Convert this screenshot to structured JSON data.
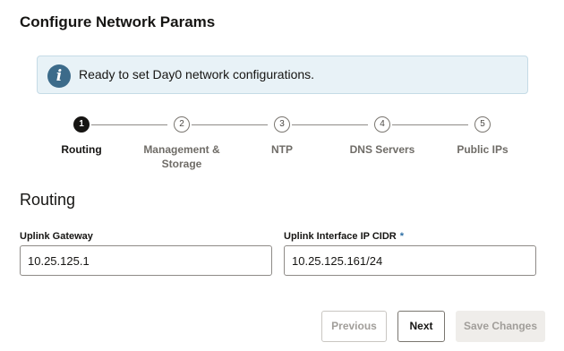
{
  "page": {
    "title": "Configure Network Params"
  },
  "info": {
    "icon": "info-icon",
    "glyph": "i",
    "message": "Ready to set Day0 network configurations."
  },
  "steps": [
    {
      "number": "1",
      "label": "Routing",
      "active": true
    },
    {
      "number": "2",
      "label": "Management &",
      "label2": "Storage",
      "active": false
    },
    {
      "number": "3",
      "label": "NTP",
      "active": false
    },
    {
      "number": "4",
      "label": "DNS Servers",
      "active": false
    },
    {
      "number": "5",
      "label": "Public IPs",
      "active": false
    }
  ],
  "section": {
    "title": "Routing"
  },
  "fields": {
    "uplink_gateway": {
      "label": "Uplink Gateway",
      "value": "10.25.125.1"
    },
    "uplink_cidr": {
      "label": "Uplink Interface IP CIDR",
      "required": "*",
      "value": "10.25.125.161/24"
    }
  },
  "buttons": {
    "previous": "Previous",
    "next": "Next",
    "save": "Save Changes"
  },
  "colors": {
    "accent": "#3c6b8a",
    "banner_bg": "#e8f2f7",
    "active_step": "#161513"
  }
}
